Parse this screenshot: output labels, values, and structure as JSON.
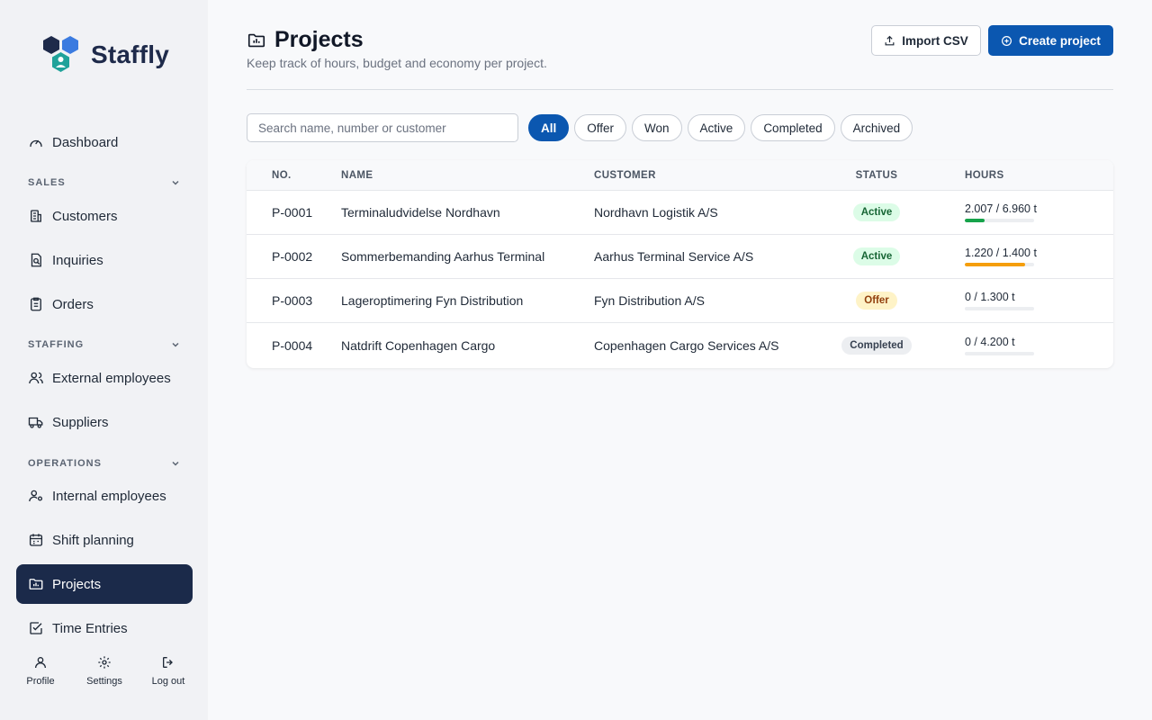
{
  "app": {
    "name": "Staffly"
  },
  "sidebar": {
    "dashboard": "Dashboard",
    "sections": {
      "sales": "SALES",
      "staffing": "STAFFING",
      "operations": "OPERATIONS"
    },
    "items": {
      "customers": "Customers",
      "inquiries": "Inquiries",
      "orders": "Orders",
      "external_employees": "External employees",
      "suppliers": "Suppliers",
      "internal_employees": "Internal employees",
      "shift_planning": "Shift planning",
      "projects": "Projects",
      "time_entries": "Time Entries"
    },
    "active": "projects",
    "bottom": {
      "profile": "Profile",
      "settings": "Settings",
      "logout": "Log out"
    }
  },
  "header": {
    "title": "Projects",
    "subtitle": "Keep track of hours, budget and economy per project.",
    "import_label": "Import CSV",
    "create_label": "Create project"
  },
  "search": {
    "placeholder": "Search name, number or customer",
    "value": ""
  },
  "filters": [
    "All",
    "Offer",
    "Won",
    "Active",
    "Completed",
    "Archived"
  ],
  "active_filter": "All",
  "table": {
    "columns": {
      "no": "NO.",
      "name": "NAME",
      "customer": "CUSTOMER",
      "status": "STATUS",
      "hours": "HOURS"
    },
    "rows": [
      {
        "no": "P-0001",
        "name": "Terminaludvidelse Nordhavn",
        "customer": "Nordhavn Logistik A/S",
        "status": "Active",
        "hours": "2.007 / 6.960 t",
        "progress": 0.29
      },
      {
        "no": "P-0002",
        "name": "Sommerbemanding Aarhus Terminal",
        "customer": "Aarhus Terminal Service A/S",
        "status": "Active",
        "hours": "1.220 / 1.400 t",
        "progress": 0.87
      },
      {
        "no": "P-0003",
        "name": "Lageroptimering Fyn Distribution",
        "customer": "Fyn Distribution A/S",
        "status": "Offer",
        "hours": "0 / 1.300 t",
        "progress": 0
      },
      {
        "no": "P-0004",
        "name": "Natdrift Copenhagen Cargo",
        "customer": "Copenhagen Cargo Services A/S",
        "status": "Completed",
        "hours": "0 / 4.200 t",
        "progress": 0
      }
    ]
  },
  "colors": {
    "primary": "#0b57b0",
    "sidebar_active": "#1b2a4a",
    "status": {
      "Active": {
        "bg": "#dcfce7",
        "fg": "#166534",
        "bar": "#16a34a"
      },
      "Offer": {
        "bg": "#fef3c7",
        "fg": "#92400e",
        "bar": "#f59e0b"
      },
      "Completed": {
        "bg": "#eceef1",
        "fg": "#374151",
        "bar": "#9ca3af"
      }
    },
    "bar_high": "#f59e0b"
  }
}
